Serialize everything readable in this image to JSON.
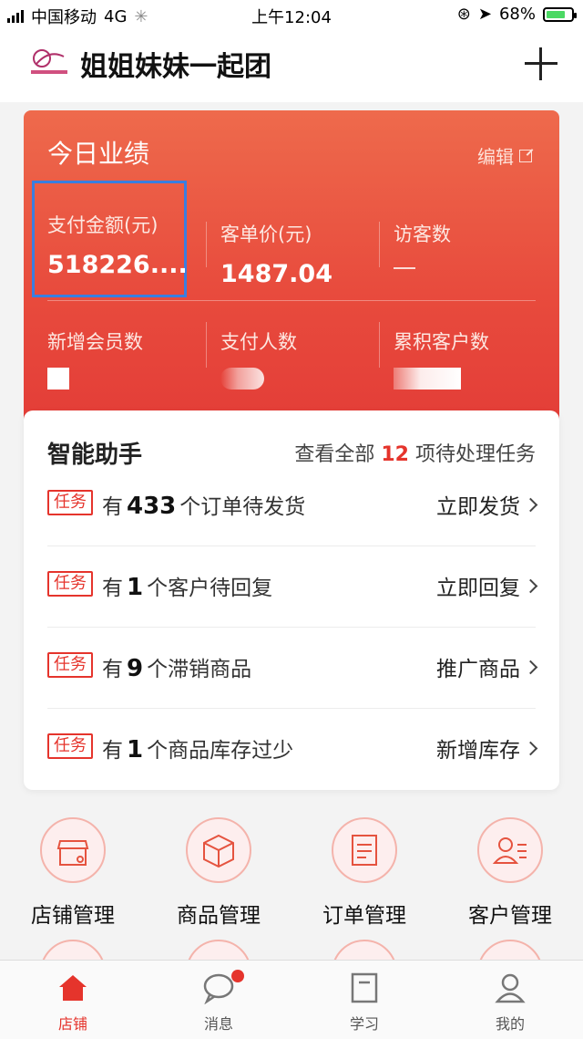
{
  "statusbar": {
    "carrier": "中国移动",
    "network": "4G",
    "time": "上午12:04",
    "battery": "68%"
  },
  "header": {
    "title": "姐姐妹妹一起团"
  },
  "performance": {
    "title": "今日业绩",
    "edit_label": "编辑",
    "metrics": [
      {
        "label": "支付金额(元)",
        "value": "518226...."
      },
      {
        "label": "客单价(元)",
        "value": "1487.04"
      },
      {
        "label": "访客数",
        "value": ""
      },
      {
        "label": "新增会员数",
        "value": ""
      },
      {
        "label": "支付人数",
        "value": ""
      },
      {
        "label": "累积客户数",
        "value": ""
      }
    ]
  },
  "assistant": {
    "title": "智能助手",
    "summary_prefix": "查看全部",
    "summary_count": "12",
    "summary_suffix": "项待处理任务",
    "tasks": [
      {
        "tag": "任务",
        "prefix": "有",
        "count": "433",
        "suffix": "个订单待发货",
        "action": "立即发货"
      },
      {
        "tag": "任务",
        "prefix": "有",
        "count": "1",
        "suffix": "个客户待回复",
        "action": "立即回复"
      },
      {
        "tag": "任务",
        "prefix": "有",
        "count": "9",
        "suffix": "个滞销商品",
        "action": "推广商品"
      },
      {
        "tag": "任务",
        "prefix": "有",
        "count": "1",
        "suffix": "个商品库存过少",
        "action": "新增库存"
      }
    ]
  },
  "menu": [
    {
      "label": "店铺管理",
      "icon": "store-icon"
    },
    {
      "label": "商品管理",
      "icon": "box-icon"
    },
    {
      "label": "订单管理",
      "icon": "order-icon"
    },
    {
      "label": "客户管理",
      "icon": "customer-icon"
    }
  ],
  "tabbar": [
    {
      "label": "店铺",
      "icon": "home-icon",
      "active": true
    },
    {
      "label": "消息",
      "icon": "message-icon",
      "badge": true
    },
    {
      "label": "学习",
      "icon": "book-icon"
    },
    {
      "label": "我的",
      "icon": "user-icon"
    }
  ],
  "colors": {
    "accent": "#e5342c",
    "card_gradient_top": "#ee6a4c",
    "card_gradient_bottom": "#e33c37",
    "highlight": "#3a7ee0"
  }
}
